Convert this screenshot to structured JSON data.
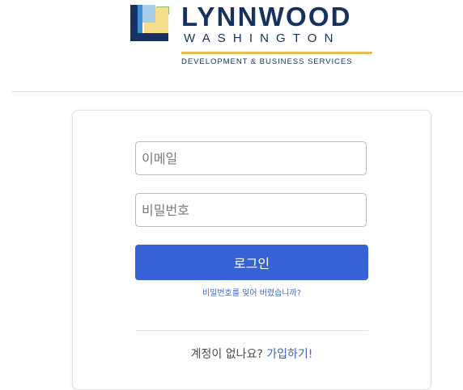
{
  "header": {
    "logo": {
      "title": "LYNNWOOD",
      "subtitle": "WASHINGTON",
      "tagline": "DEVELOPMENT & BUSINESS SERVICES",
      "colors": {
        "navy": "#16305f",
        "gold": "#e5bf52",
        "light_gold": "#f5df8e",
        "sky": "#a9ceea",
        "blue": "#3a8fd6",
        "green": "#8ec06c"
      }
    }
  },
  "login": {
    "email_placeholder": "이메일",
    "password_placeholder": "비밀번호",
    "login_label": "로그인",
    "forgot_label": "비밀번호를 잊어 버렸습니까?",
    "signup_prompt": "계정이 없나요?",
    "signup_label": "가입하기!",
    "colors": {
      "button": "#3662d6",
      "link": "#3a63c7"
    }
  }
}
